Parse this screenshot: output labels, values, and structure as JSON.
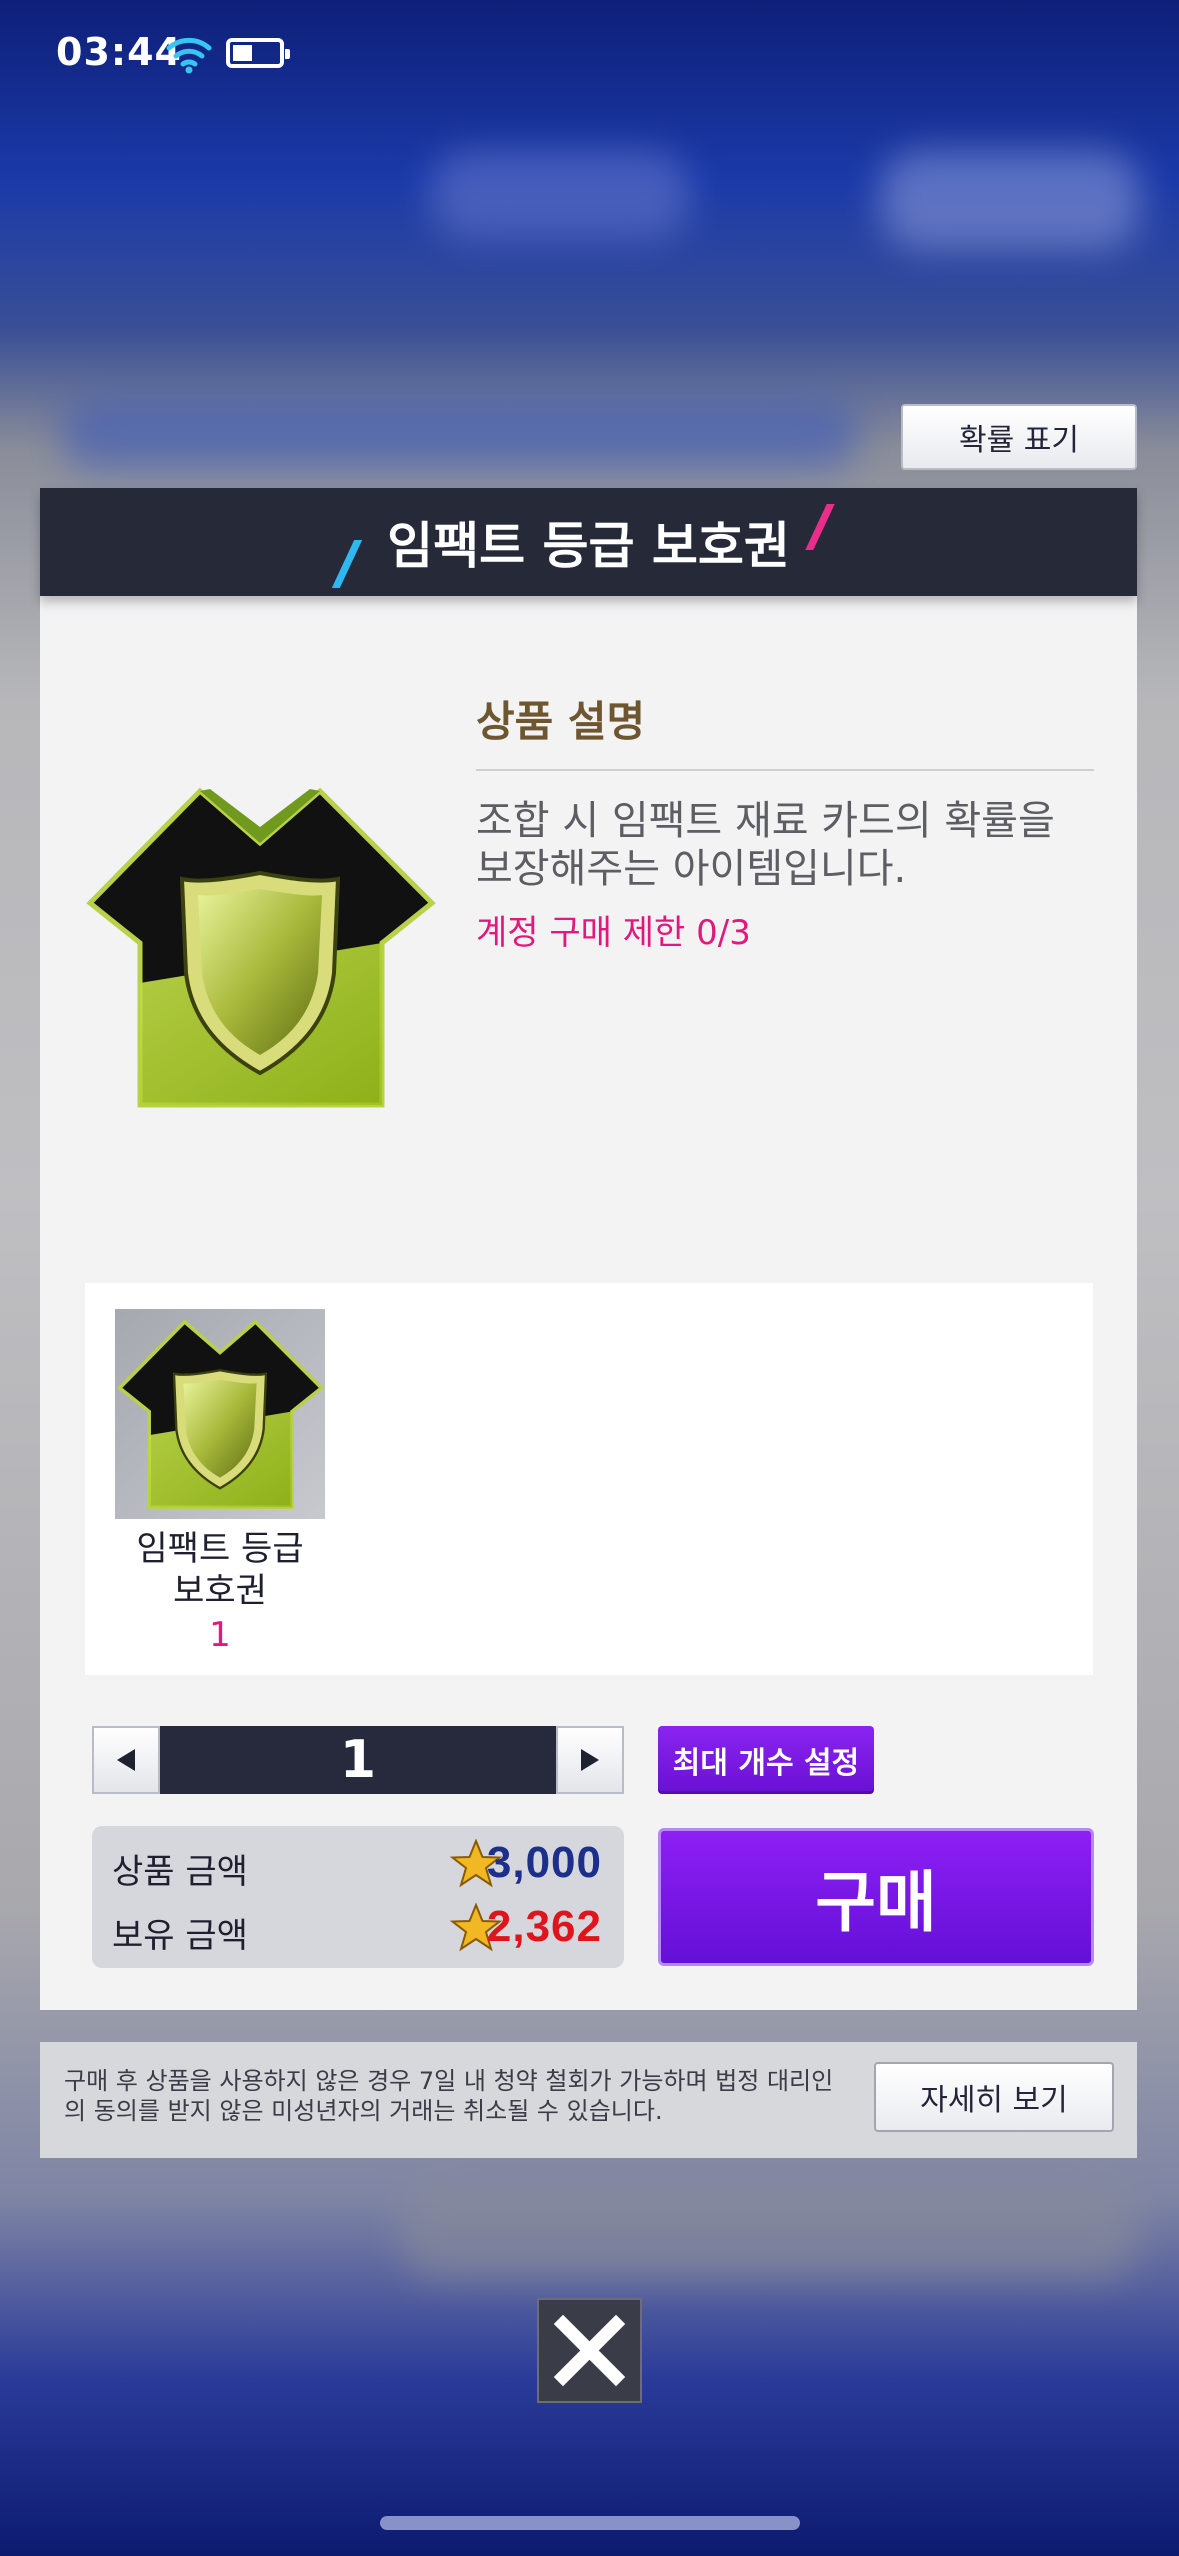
{
  "status_bar": {
    "time": "03:44"
  },
  "probability_button": "확률 표기",
  "modal": {
    "title": "임팩트 등급 보호권",
    "description_title": "상품 설명",
    "description_text": "조합 시 임팩트 재료 카드의 확률을 보장해주는 아이템입니다.",
    "purchase_limit": "계정 구매 제한 0/3"
  },
  "items": [
    {
      "name": "임팩트 등급\n보호권",
      "quantity": "1"
    }
  ],
  "quantity": {
    "value": "1",
    "max_button": "최대 개수 설정"
  },
  "price": {
    "product_label": "상품 금액",
    "product_value": "3,000",
    "owned_label": "보유 금액",
    "owned_value": "2,362"
  },
  "buy_button": "구매",
  "notice": {
    "text": "구매 후 상품을 사용하지 않은 경우 7일 내 청약 철회가 가능하며 법정 대리인의 동의를 받지 않은 미성년자의 거래는 취소될 수 있습니다.",
    "detail_button": "자세히 보기"
  },
  "colors": {
    "header_bg": "#262a38",
    "accent_purple": "#7a18e6",
    "limit_pink": "#e2187c",
    "price_blue": "#1c2f8a",
    "owned_red": "#e0141c"
  }
}
